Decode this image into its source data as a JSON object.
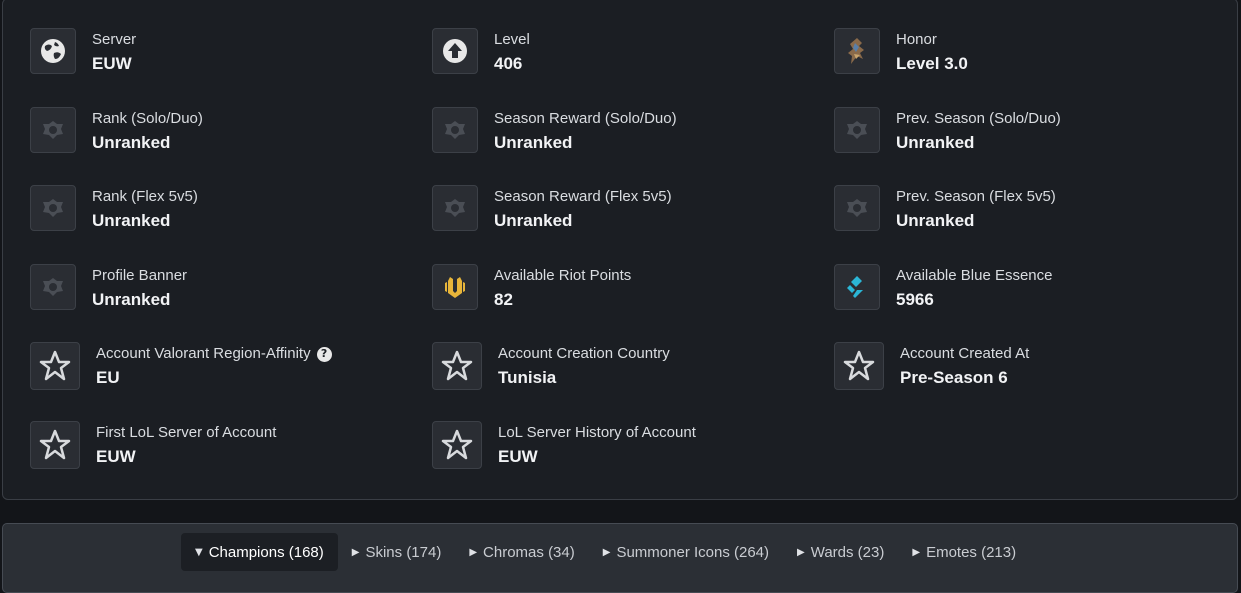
{
  "stats": [
    {
      "icon": "globe-icon",
      "label": "Server",
      "value": "EUW"
    },
    {
      "icon": "level-up-icon",
      "label": "Level",
      "value": "406"
    },
    {
      "icon": "honor-icon",
      "label": "Honor",
      "value": "Level 3.0"
    },
    {
      "icon": "unranked-emblem-icon",
      "label": "Rank (Solo/Duo)",
      "value": "Unranked"
    },
    {
      "icon": "unranked-emblem-icon",
      "label": "Season Reward (Solo/Duo)",
      "value": "Unranked"
    },
    {
      "icon": "unranked-emblem-icon",
      "label": "Prev. Season (Solo/Duo)",
      "value": "Unranked"
    },
    {
      "icon": "unranked-emblem-icon",
      "label": "Rank (Flex 5v5)",
      "value": "Unranked"
    },
    {
      "icon": "unranked-emblem-icon",
      "label": "Season Reward (Flex 5v5)",
      "value": "Unranked"
    },
    {
      "icon": "unranked-emblem-icon",
      "label": "Prev. Season (Flex 5v5)",
      "value": "Unranked"
    },
    {
      "icon": "unranked-emblem-icon",
      "label": "Profile Banner",
      "value": "Unranked"
    },
    {
      "icon": "riot-points-icon",
      "label": "Available Riot Points",
      "value": "82"
    },
    {
      "icon": "blue-essence-icon",
      "label": "Available Blue Essence",
      "value": "5966"
    },
    {
      "icon": "star-icon",
      "label": "Account Valorant Region-Affinity",
      "value": "EU"
    },
    {
      "icon": "star-icon",
      "label": "Account Creation Country",
      "value": "Tunisia"
    },
    {
      "icon": "star-icon",
      "label": "Account Created At",
      "value": "Pre-Season 6"
    },
    {
      "icon": "star-icon",
      "label": "First LoL Server of Account",
      "value": "EUW"
    },
    {
      "icon": "star-icon",
      "label": "LoL Server History of Account",
      "value": "EUW"
    }
  ],
  "help_glyph": "?",
  "tabs": [
    {
      "label": "Champions (168)",
      "active": true,
      "caret": "▼"
    },
    {
      "label": "Skins (174)",
      "active": false,
      "caret": "▶"
    },
    {
      "label": "Chromas (34)",
      "active": false,
      "caret": "▶"
    },
    {
      "label": "Summoner Icons (264)",
      "active": false,
      "caret": "▶"
    },
    {
      "label": "Wards (23)",
      "active": false,
      "caret": "▶"
    },
    {
      "label": "Emotes (213)",
      "active": false,
      "caret": "▶"
    }
  ],
  "colors": {
    "riot_points": "#e8b53a",
    "blue_essence": "#2bb6d6",
    "emblem": "#4a4e55"
  }
}
